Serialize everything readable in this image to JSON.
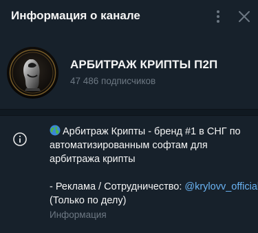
{
  "header": {
    "title": "Информация о канале"
  },
  "channel": {
    "name": "АРБИТРАЖ КРИПТЫ П2П",
    "subscribers": "47 486 подписчиков"
  },
  "info": {
    "icon": "globe-emoji",
    "desc_line1": "Арбитраж Крипты - бренд #1 в СНГ по",
    "desc_line2": "автоматизированным софтам для",
    "desc_line3": "арбитража крипты",
    "contact_prefix": "- Реклама / Сотрудничество: ",
    "contact_link": "@krylovv_official",
    "note": "(Только по делу)",
    "label": "Информация"
  },
  "colors": {
    "background": "#17212b",
    "text": "#f5f5f5",
    "secondary": "#6d7883",
    "link": "#6ab3f3"
  }
}
